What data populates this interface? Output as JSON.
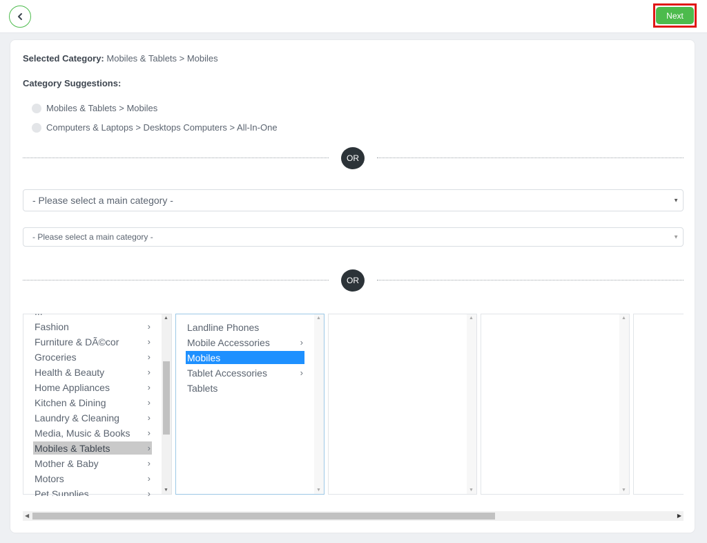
{
  "header": {
    "next_label": "Next",
    "accent_color": "#4cbb4c",
    "highlight_color": "#e01616"
  },
  "selected": {
    "label": "Selected Category:",
    "value": "Mobiles & Tablets > Mobiles"
  },
  "suggestions": {
    "title": "Category Suggestions:",
    "items": [
      "Mobiles & Tablets > Mobiles",
      "Computers & Laptops > Desktops Computers > All-In-One"
    ]
  },
  "or_label": "OR",
  "selects": {
    "main_category": "- Please select a main category -",
    "sub_category": "- Please select a main category -"
  },
  "columns": {
    "main": {
      "partial_top": "...",
      "items": [
        {
          "label": "Fashion",
          "has_children": true
        },
        {
          "label": "Furniture & DÃ©cor",
          "has_children": true
        },
        {
          "label": "Groceries",
          "has_children": true
        },
        {
          "label": "Health & Beauty",
          "has_children": true
        },
        {
          "label": "Home Appliances",
          "has_children": true
        },
        {
          "label": "Kitchen & Dining",
          "has_children": true
        },
        {
          "label": "Laundry & Cleaning",
          "has_children": true
        },
        {
          "label": "Media, Music & Books",
          "has_children": true
        },
        {
          "label": "Mobiles & Tablets",
          "has_children": true,
          "selected": true
        },
        {
          "label": "Mother & Baby",
          "has_children": true
        },
        {
          "label": "Motors",
          "has_children": true
        },
        {
          "label": "Pet Supplies",
          "has_children": true
        }
      ]
    },
    "sub": {
      "items": [
        {
          "label": "Landline Phones",
          "has_children": false
        },
        {
          "label": "Mobile Accessories",
          "has_children": true
        },
        {
          "label": "Mobiles",
          "has_children": false,
          "selected": true
        },
        {
          "label": "Tablet Accessories",
          "has_children": true
        },
        {
          "label": "Tablets",
          "has_children": false
        }
      ]
    }
  },
  "icons": {
    "back": "chevron-left-icon",
    "submenu": "chevron-right-icon"
  }
}
